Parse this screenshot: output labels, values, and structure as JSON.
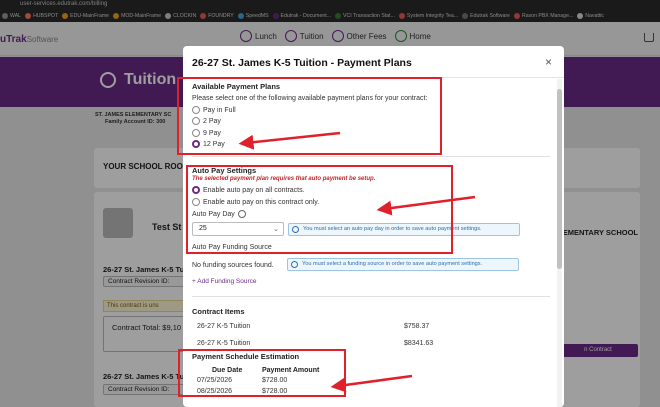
{
  "browser": {
    "url": "user-services.edutrak.com/billing",
    "bookmarks": [
      "WAL",
      "HUBSPOT",
      "EDU-MainFrame",
      "MOD-MainFrame",
      "CLOCKIN",
      "FOUNDRY",
      "SpeedMS",
      "Edutrak - Document...",
      "VCI Transaction Stat...",
      "System Integrity Tea...",
      "Edutrak Software",
      "Raxon PBX Manage...",
      "Navattic"
    ]
  },
  "app": {
    "brand": "uTrak",
    "brand_suffix": "Software",
    "nav": [
      "Lunch",
      "Tuition",
      "Other Fees",
      "Home"
    ],
    "banner_title": "Tuition"
  },
  "background": {
    "school_name": "ST. JAMES ELEMENTARY SC",
    "family_id": "Family Account ID: 300",
    "card_title": "YOUR SCHOOL ROO",
    "test_name": "Test St",
    "right_school": "ELEMENTARY SCHOOL",
    "contract_1": "26-27 St. James K-5 Tu",
    "revision_1": "Contract Revision ID:",
    "warning": "This contract is uns",
    "total": "Contract Total: $9,10",
    "contract_2": "26-27 St. James K-5 Tu",
    "revision_2": "Contract Revision ID:",
    "button": "n Contract"
  },
  "modal": {
    "title": "26-27 St. James K-5 Tuition - Payment Plans",
    "close": "×",
    "plans": {
      "heading": "Available Payment Plans",
      "instruction": "Please select one of the following available payment plans for your contract:",
      "options": [
        "Pay in Full",
        "2 Pay",
        "9 Pay",
        "12 Pay"
      ],
      "selected": "12 Pay"
    },
    "autopay": {
      "heading": "Auto Pay Settings",
      "warning": "The selected payment plan requires that auto payment be setup.",
      "options": [
        "Enable auto pay on all contracts.",
        "Enable auto pay on this contract only."
      ],
      "selected": "Enable auto pay on all contracts.",
      "day_label": "Auto Pay Day",
      "day_value": "25",
      "day_info": "You must select an auto pay day in order to save auto payment settings.",
      "funding_label": "Auto Pay Funding Source",
      "funding_none": "No funding sources found.",
      "funding_info": "You must select a funding source in order to save auto payment settings.",
      "add_funding": "+ Add Funding Source"
    },
    "items": {
      "heading": "Contract Items",
      "rows": [
        {
          "name": "26-27 K-5 Tuition",
          "amount": "$758.37"
        },
        {
          "name": "26-27 K-5 Tuition",
          "amount": "$8341.63"
        }
      ]
    },
    "schedule": {
      "heading": "Payment Schedule Estimation",
      "columns": [
        "Due Date",
        "Payment Amount"
      ],
      "rows": [
        {
          "date": "07/25/2026",
          "amount": "$728.00"
        },
        {
          "date": "08/25/2026",
          "amount": "$728.00"
        }
      ]
    }
  }
}
